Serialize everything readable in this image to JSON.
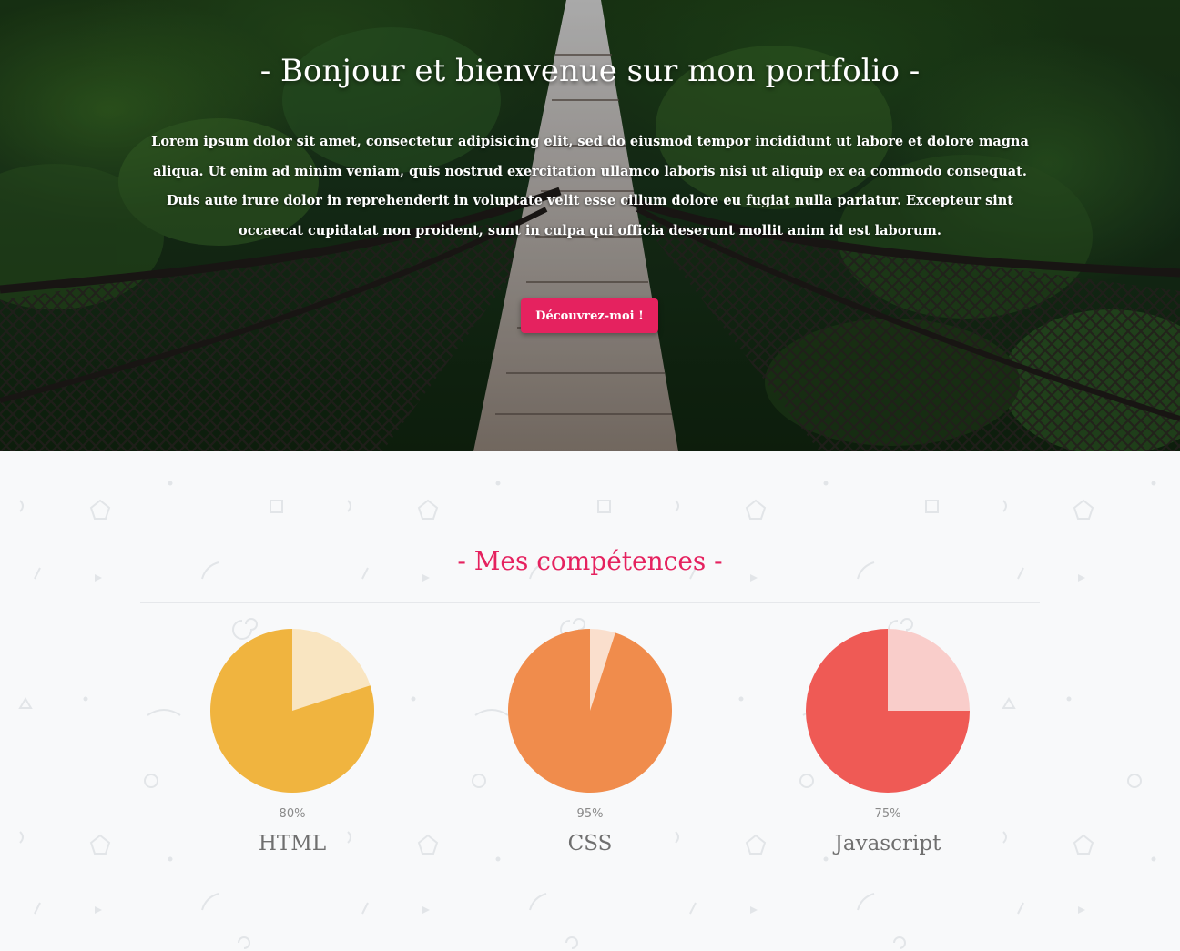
{
  "hero": {
    "title": "- Bonjour et bienvenue sur mon portfolio -",
    "text": "Lorem ipsum dolor sit amet, consectetur adipisicing elit, sed do eiusmod tempor incididunt ut labore et dolore magna aliqua. Ut enim ad minim veniam, quis nostrud exercitation ullamco laboris nisi ut aliquip ex ea commodo consequat. Duis aute irure dolor in reprehenderit in voluptate velit esse cillum dolore eu fugiat nulla pariatur. Excepteur sint occaecat cupidatat non proident, sunt in culpa qui officia deserunt mollit anim id est laborum.",
    "button_label": "Découvrez-moi !",
    "button_color": "#e5225f"
  },
  "skills": {
    "title": "- Mes compétences -",
    "title_color": "#e5225f",
    "items": [
      {
        "name": "HTML",
        "percent_label": "80%",
        "value": 80,
        "color": "#f0b43f",
        "light_color": "#f9e5c1"
      },
      {
        "name": "CSS",
        "percent_label": "95%",
        "value": 95,
        "color": "#f08c4c",
        "light_color": "#fadfcd"
      },
      {
        "name": "Javascript",
        "percent_label": "75%",
        "value": 75,
        "color": "#ef5a55",
        "light_color": "#f9cdca"
      }
    ]
  }
}
